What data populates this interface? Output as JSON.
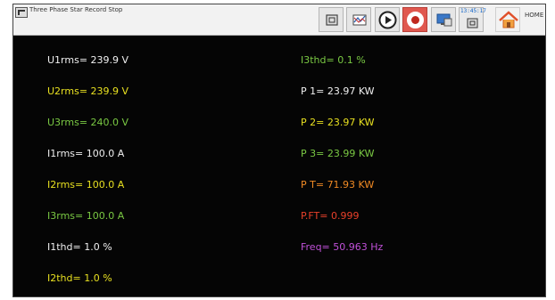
{
  "window": {
    "title": "Three Phase Star Record Stop",
    "clock": "13:45:17",
    "home_label": "HOME"
  },
  "colors": {
    "white": "#f0f0f0",
    "yellow": "#e8e020",
    "green": "#7ac943",
    "orange": "#f08a24",
    "red": "#e8402a",
    "magenta": "#c050d8"
  },
  "toolbar": {
    "buttons": [
      "copy-icon",
      "chart-icon",
      "play-icon",
      "record-icon",
      "monitor-icon",
      "clock-icon",
      "home-icon"
    ]
  },
  "readings": {
    "left": [
      {
        "text": "U1rms= 239.9 V",
        "color": "white"
      },
      {
        "text": "U2rms= 239.9 V",
        "color": "yellow"
      },
      {
        "text": "U3rms= 240.0 V",
        "color": "green"
      },
      {
        "text": "I1rms= 100.0 A",
        "color": "white"
      },
      {
        "text": "I2rms= 100.0 A",
        "color": "yellow"
      },
      {
        "text": "I3rms= 100.0 A",
        "color": "green"
      },
      {
        "text": "I1thd= 1.0 %",
        "color": "white"
      },
      {
        "text": "I2thd= 1.0 %",
        "color": "yellow"
      }
    ],
    "right": [
      {
        "text": "I3thd= 0.1 %",
        "color": "green"
      },
      {
        "text": "P 1= 23.97 KW",
        "color": "white"
      },
      {
        "text": "P 2= 23.97 KW",
        "color": "yellow"
      },
      {
        "text": "P 3= 23.99 KW",
        "color": "green"
      },
      {
        "text": "P T= 71.93 KW",
        "color": "orange"
      },
      {
        "text": "P.FT= 0.999",
        "color": "red"
      },
      {
        "text": "Freq= 50.963 Hz",
        "color": "magenta"
      }
    ]
  }
}
